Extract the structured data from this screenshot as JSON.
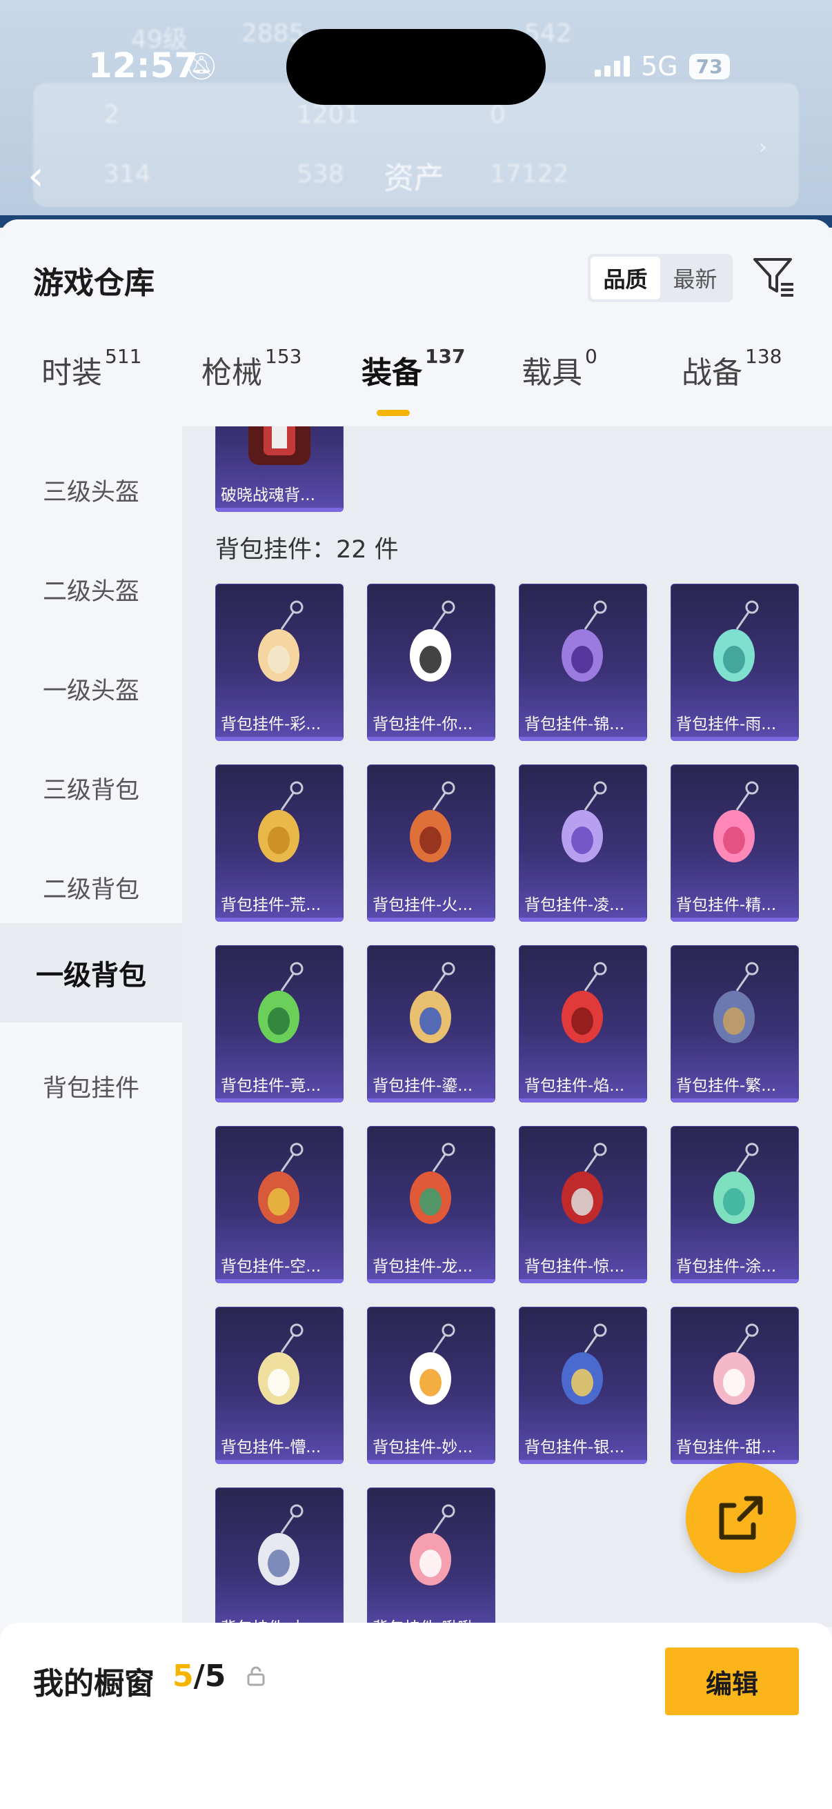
{
  "status_bar": {
    "time": "12:57",
    "network": "5G",
    "battery": "73"
  },
  "background": {
    "title": "资产",
    "ghost": [
      "49级",
      "2885",
      "542",
      "2",
      "1201",
      "0",
      "314",
      "538",
      "17122"
    ]
  },
  "sheet": {
    "title": "游戏仓库",
    "sort_options": [
      "品质",
      "最新"
    ],
    "active_sort": "品质"
  },
  "tabs": [
    {
      "label": "时装",
      "count": "511"
    },
    {
      "label": "枪械",
      "count": "153"
    },
    {
      "label": "装备",
      "count": "137"
    },
    {
      "label": "载具",
      "count": "0"
    },
    {
      "label": "战备",
      "count": "138"
    }
  ],
  "active_tab": "装备",
  "sidebar": {
    "items": [
      "三级头盔",
      "二级头盔",
      "一级头盔",
      "三级背包",
      "二级背包",
      "一级背包",
      "背包挂件"
    ],
    "active": "一级背包"
  },
  "content": {
    "top_item": "破晓战魂背...",
    "section_label": "背包挂件：22 件",
    "items": [
      "背包挂件-彩...",
      "背包挂件-你...",
      "背包挂件-锦...",
      "背包挂件-雨...",
      "背包挂件-荒...",
      "背包挂件-火...",
      "背包挂件-凌...",
      "背包挂件-精...",
      "背包挂件-竟...",
      "背包挂件-鎏...",
      "背包挂件-焰...",
      "背包挂件-繁...",
      "背包挂件-空...",
      "背包挂件-龙...",
      "背包挂件-惊...",
      "背包挂件-涂...",
      "背包挂件-懵...",
      "背包挂件-妙...",
      "背包挂件-银...",
      "背包挂件-甜...",
      "背包挂件-太...",
      "背包挂件-啾啾"
    ]
  },
  "showcase": {
    "label": "我的橱窗",
    "current": "5",
    "total": "/5",
    "edit_label": "编辑"
  },
  "colors": {
    "accent": "#fbb41a",
    "card_top": "#2a2550",
    "card_bottom": "#5b4cb0"
  }
}
